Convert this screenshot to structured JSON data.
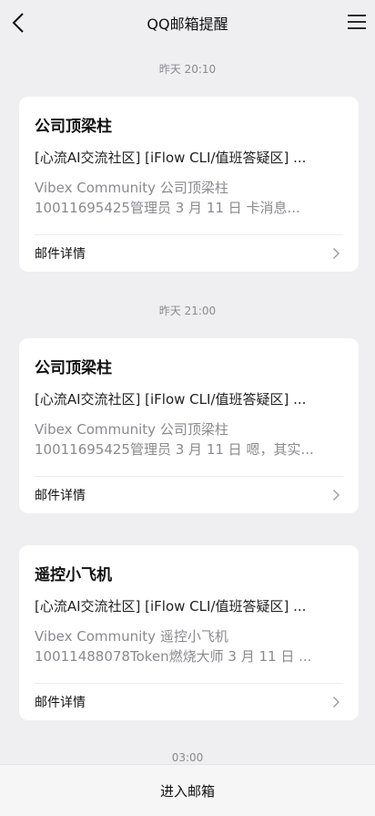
{
  "header": {
    "title": "QQ邮箱提醒",
    "back_icon": "chevron-left-icon",
    "menu_icon": "hamburger-menu-icon"
  },
  "messages": [
    {
      "time": "昨天 20:10",
      "sender": "公司顶梁柱",
      "subject": "[心流AI交流社区] [iFlow CLI/值班答疑区] ...",
      "preview_line1": "Vibex Community   公司顶梁柱",
      "preview_line2": "10011695425管理员 3 月 11 日   卡消息...",
      "detail_label": "邮件详情"
    },
    {
      "time": "昨天 21:00",
      "sender": "公司顶梁柱",
      "subject": "[心流AI交流社区] [iFlow CLI/值班答疑区] ...",
      "preview_line1": "Vibex Community   公司顶梁柱",
      "preview_line2": "10011695425管理员 3 月 11 日   嗯，其实...",
      "detail_label": "邮件详情"
    },
    {
      "time": "",
      "sender": "遥控小飞机",
      "subject": "[心流AI交流社区] [iFlow CLI/值班答疑区] ...",
      "preview_line1": "Vibex Community   遥控小飞机",
      "preview_line2": "10011488078Token燃烧大师 3 月 11 日   ...",
      "detail_label": "邮件详情"
    }
  ],
  "next_time": "03:00",
  "footer": {
    "enter_mailbox": "进入邮箱"
  }
}
